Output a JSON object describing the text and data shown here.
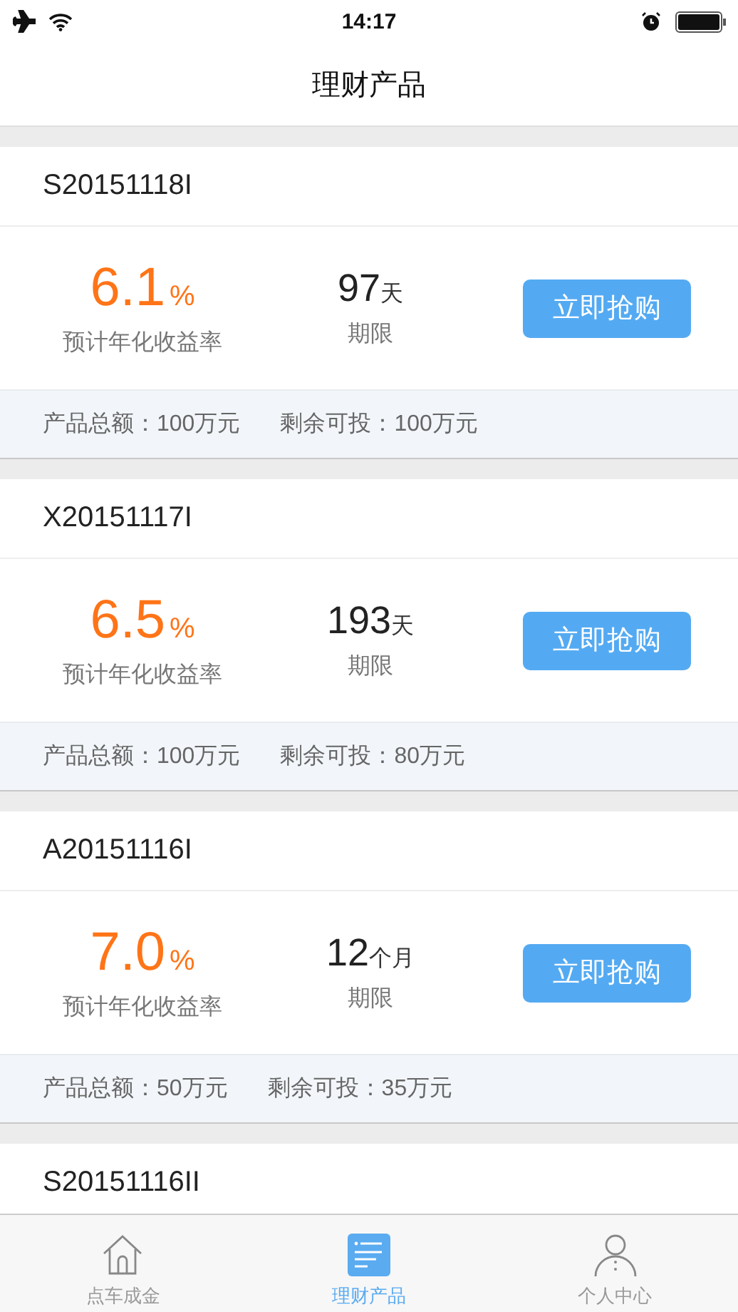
{
  "status_bar": {
    "time": "14:17"
  },
  "nav": {
    "title": "理财产品"
  },
  "products": [
    {
      "code": "S20151118I",
      "rate": "6.1",
      "rate_unit": "%",
      "rate_label": "预计年化收益率",
      "term": "97",
      "term_unit": "天",
      "term_label": "期限",
      "button": "立即抢购",
      "total": "产品总额：100万元",
      "remaining": "剩余可投：100万元"
    },
    {
      "code": "X20151117I",
      "rate": "6.5",
      "rate_unit": "%",
      "rate_label": "预计年化收益率",
      "term": "193",
      "term_unit": "天",
      "term_label": "期限",
      "button": "立即抢购",
      "total": "产品总额：100万元",
      "remaining": "剩余可投：80万元"
    },
    {
      "code": "A20151116I",
      "rate": "7.0",
      "rate_unit": "%",
      "rate_label": "预计年化收益率",
      "term": "12",
      "term_unit": "个月",
      "term_label": "期限",
      "button": "立即抢购",
      "total": "产品总额：50万元",
      "remaining": "剩余可投：35万元"
    },
    {
      "code": "S20151116II"
    }
  ],
  "tab_bar": [
    {
      "kind": "home",
      "label": "点车成金",
      "selected": false
    },
    {
      "kind": "list",
      "label": "理财产品",
      "selected": true
    },
    {
      "kind": "person",
      "label": "个人中心",
      "selected": false
    }
  ]
}
